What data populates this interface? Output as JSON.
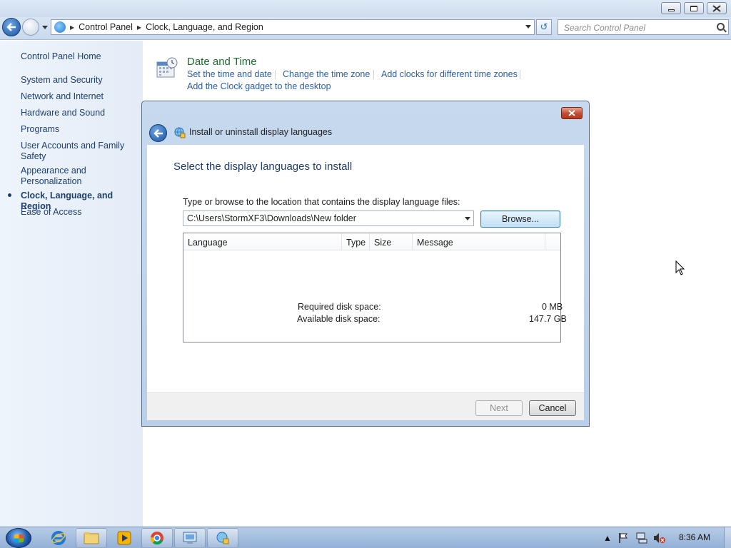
{
  "window": {
    "caption_buttons": [
      "minimize",
      "restore",
      "close"
    ]
  },
  "navbar": {
    "breadcrumbs": [
      "Control Panel",
      "Clock, Language, and Region"
    ],
    "search_placeholder": "Search Control Panel"
  },
  "sidebar": {
    "items": [
      {
        "label": "Control Panel Home"
      },
      {
        "label": "System and Security"
      },
      {
        "label": "Network and Internet"
      },
      {
        "label": "Hardware and Sound"
      },
      {
        "label": "Programs"
      },
      {
        "label": "User Accounts and Family Safety"
      },
      {
        "label": "Appearance and Personalization"
      },
      {
        "label": "Clock, Language, and Region",
        "active": true
      },
      {
        "label": "Ease of Access"
      }
    ]
  },
  "main": {
    "section_title": "Date and Time",
    "links": [
      "Set the time and date",
      "Change the time zone",
      "Add clocks for different time zones",
      "Add the Clock gadget to the desktop"
    ]
  },
  "dialog": {
    "title": "Install or uninstall display languages",
    "heading": "Select the display languages to install",
    "prompt": "Type or browse to the location that contains the display language files:",
    "path_value": "C:\\Users\\StormXF3\\Downloads\\New folder",
    "browse_label": "Browse...",
    "columns": [
      "Language",
      "Type",
      "Size",
      "Message"
    ],
    "rows": [],
    "required_label": "Required disk space:",
    "required_value": "0 MB",
    "available_label": "Available disk space:",
    "available_value": "147.7 GB",
    "next_label": "Next",
    "next_enabled": false,
    "cancel_label": "Cancel"
  },
  "taskbar": {
    "apps": [
      "internet-explorer-icon",
      "windows-explorer-icon",
      "media-player-icon",
      "chrome-icon",
      "control-panel-icon",
      "language-installer-icon"
    ],
    "clock": "8:36 AM"
  },
  "colors": {
    "link": "#2b5ea7",
    "section_title": "#1e6b2f",
    "heading": "#1e3a6d",
    "sidebar_text": "#1e3f6d"
  }
}
